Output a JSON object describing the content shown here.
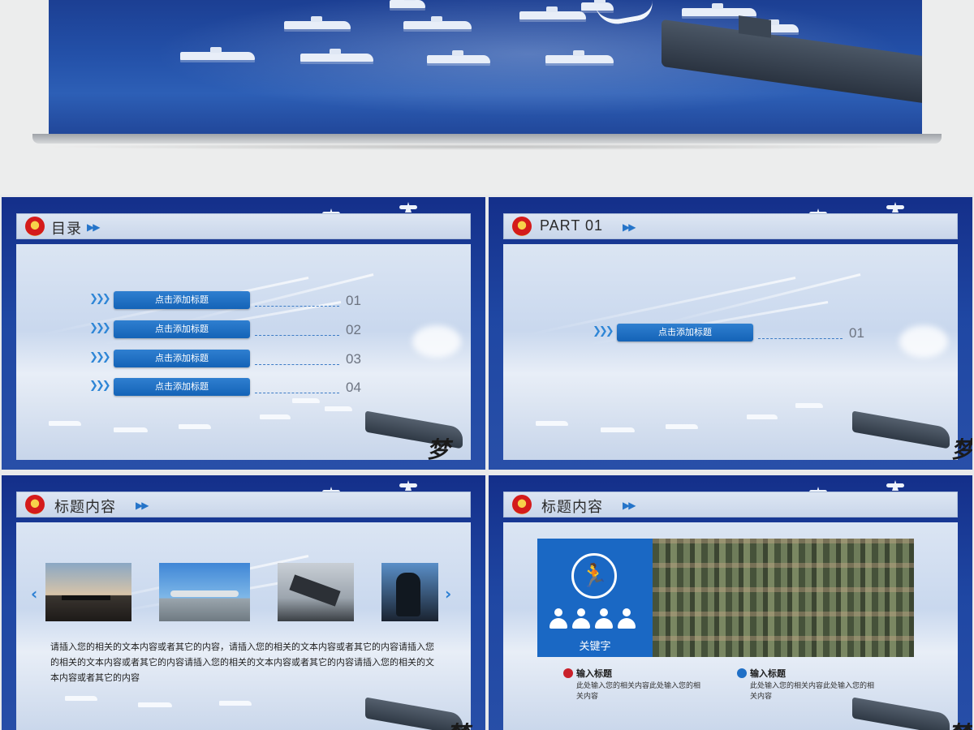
{
  "toc": {
    "title": "目录",
    "items": [
      {
        "label": "点击添加标题",
        "num": "01"
      },
      {
        "label": "点击添加标题",
        "num": "02"
      },
      {
        "label": "点击添加标题",
        "num": "03"
      },
      {
        "label": "点击添加标题",
        "num": "04"
      }
    ]
  },
  "part": {
    "title": "PART 01",
    "item_label": "点击添加标题",
    "item_num": "01"
  },
  "gallery": {
    "title": "标题内容",
    "prev_icon": "chevron-left-icon",
    "next_icon": "chevron-right-icon",
    "paragraph": "请插入您的相关的文本内容或者其它的内容，请插入您的相关的文本内容或者其它的内容请插入您的相关的文本内容或者其它的内容请插入您的相关的文本内容或者其它的内容请插入您的相关的文本内容或者其它的内容"
  },
  "keyword": {
    "title": "标题内容",
    "label": "关键字",
    "icon": "running-man-icon",
    "bullets": [
      {
        "title": "输入标题",
        "desc": "此处输入您的相关内容此处输入您的相关内容",
        "color": "#c9202a"
      },
      {
        "title": "输入标题",
        "desc": "此处输入您的相关内容此处输入您的相关内容",
        "color": "#1f6fc6"
      }
    ]
  },
  "colors": {
    "accent": "#1a68c4",
    "navy": "#1f47a3"
  }
}
